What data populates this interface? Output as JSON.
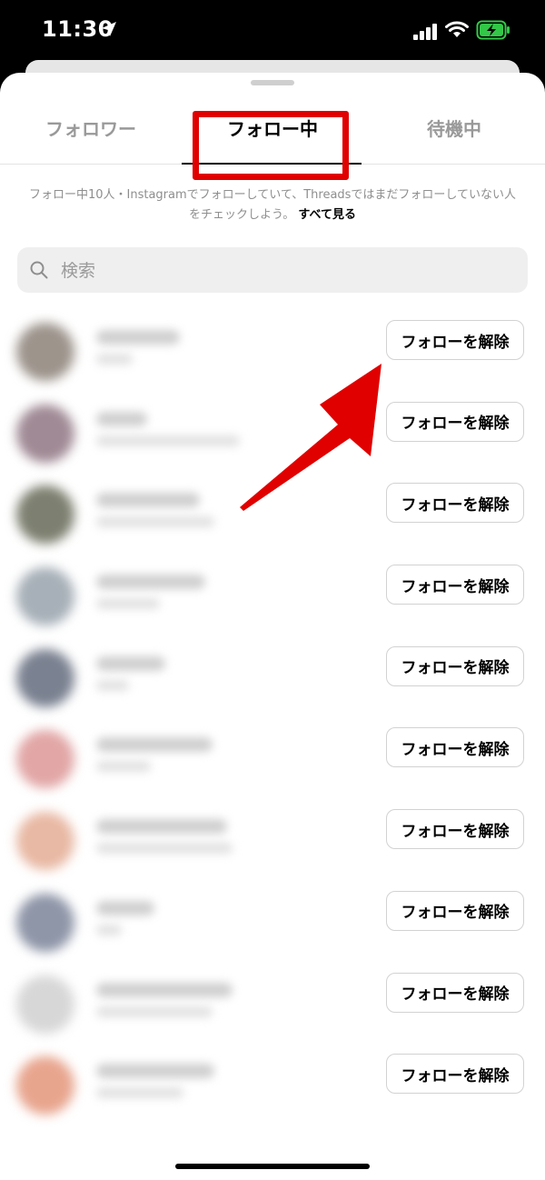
{
  "status_bar": {
    "time": "11:30"
  },
  "tabs": [
    {
      "label": "フォロワー",
      "active": false
    },
    {
      "label": "フォロー中",
      "active": true
    },
    {
      "label": "待機中",
      "active": false
    }
  ],
  "info": {
    "text": "フォロー中10人・Instagramでフォローしていて、Threadsではまだフォローしていない人をチェックしよう。",
    "link": "すべて見る"
  },
  "search": {
    "placeholder": "検索",
    "value": ""
  },
  "rows": [
    {
      "button": "フォローを解除",
      "avatar_color": "#9d948c"
    },
    {
      "button": "フォローを解除",
      "avatar_color": "#a08a95"
    },
    {
      "button": "フォローを解除",
      "avatar_color": "#7d8070"
    },
    {
      "button": "フォローを解除",
      "avatar_color": "#a7b0b8"
    },
    {
      "button": "フォローを解除",
      "avatar_color": "#7a8190"
    },
    {
      "button": "フォローを解除",
      "avatar_color": "#e2a6a6"
    },
    {
      "button": "フォローを解除",
      "avatar_color": "#e8b9a4"
    },
    {
      "button": "フォローを解除",
      "avatar_color": "#8f96a8"
    },
    {
      "button": "フォローを解除",
      "avatar_color": "#d7d7d7"
    },
    {
      "button": "フォローを解除",
      "avatar_color": "#e8a58e"
    }
  ],
  "colors": {
    "highlight": "#e00000",
    "tab_inactive": "#999999",
    "text": "#000000"
  }
}
